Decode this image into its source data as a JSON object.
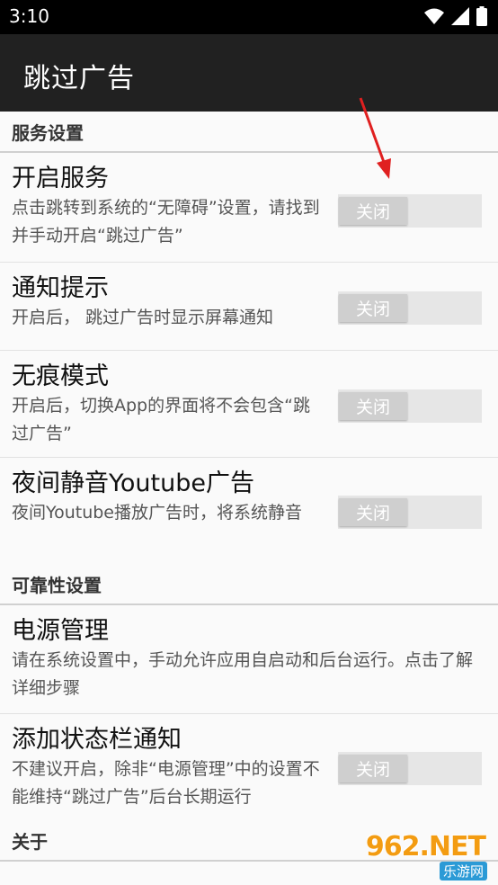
{
  "status_bar": {
    "time": "3:10"
  },
  "app_bar": {
    "title": "跳过广告"
  },
  "sections": {
    "service": "服务设置",
    "reliability": "可靠性设置",
    "about": "关于"
  },
  "prefs": {
    "start_service": {
      "title": "开启服务",
      "summary": "点击跳转到系统的“无障碍”设置，请找到并手动开启“跳过广告”",
      "switch_label": "关闭"
    },
    "notification_hint": {
      "title": "通知提示",
      "summary": "开启后， 跳过广告时显示屏幕通知",
      "switch_label": "关闭"
    },
    "incognito": {
      "title": "无痕模式",
      "summary": "开启后，切换App的界面将不会包含“跳过广告”",
      "switch_label": "关闭"
    },
    "night_mute": {
      "title": "夜间静音Youtube广告",
      "summary": "夜间Youtube播放广告时，将系统静音",
      "switch_label": "关闭"
    },
    "power_management": {
      "title": "电源管理",
      "summary": "请在系统设置中，手动允许应用自启动和后台运行。点击了解详细步骤"
    },
    "status_bar_notification": {
      "title": "添加状态栏通知",
      "summary": "不建议开启，除非“电源管理”中的设置不能维持“跳过广告”后台长期运行",
      "switch_label": "关闭"
    }
  },
  "watermark": {
    "brand": "962.NET",
    "sub": "乐游网"
  },
  "colors": {
    "app_bar": "#212121",
    "arrow": "#e02020",
    "switch_off": "#cfcfcf"
  }
}
